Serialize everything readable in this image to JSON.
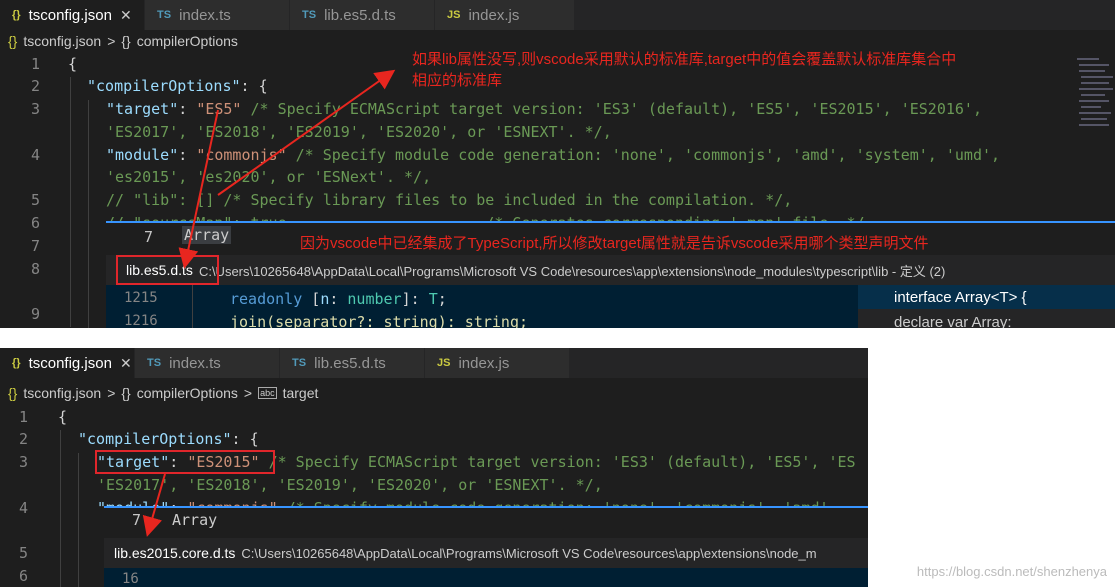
{
  "shot1": {
    "tabs": [
      {
        "icon": "{}",
        "label": "tsconfig.json",
        "close": "✕"
      },
      {
        "icon": "TS",
        "label": "index.ts"
      },
      {
        "icon": "TS",
        "label": "lib.es5.d.ts"
      },
      {
        "icon": "JS",
        "label": "index.js"
      }
    ],
    "breadcrumb": [
      "{}",
      "tsconfig.json",
      ">",
      "{}",
      "compilerOptions"
    ],
    "annotation_top": "如果lib属性没写,则vscode采用默认的标准库,target中的值会覆盖默认标准库集合中",
    "annotation_top2": "相应的标准库",
    "annotation_mid": "因为vscode中已经集成了TypeScript,所以修改target属性就是告诉vscode采用哪个类型声明文件",
    "lines": {
      "l1": "1",
      "l2": "2",
      "l3": "3",
      "l4": "4",
      "l5": "5",
      "l6": "6",
      "l7": "7",
      "l8": "8",
      "l9": "9"
    },
    "code": {
      "brace": "{",
      "compilerOptions": "\"compilerOptions\"",
      "colon_brace": ": {",
      "target_key": "\"target\"",
      "target_val": "\"ES5\"",
      "target_comment": " /* Specify ECMAScript target version: 'ES3' (default), 'ES5', 'ES2015', 'ES2016',",
      "target_comment2": "'ES2017', 'ES2018', 'ES2019', 'ES2020', or 'ESNEXT'. */,",
      "module_key": "\"module\"",
      "module_val": "\"commonjs\"",
      "module_comment": " /* Specify module code generation: 'none', 'commonjs', 'amd', 'system', 'umd',",
      "module_comment2": "'es2015', 'es2020', or 'ESNext'. */,",
      "lib_line": "// \"lib\": [] /* Specify library files to be included in the compilation. */,",
      "sourcemap_line": "// \"sourceMap\": true,                     /* Generates corresponding '.map' file. */"
    },
    "peek": {
      "line_no": "7",
      "word": "Array",
      "file": "lib.es5.d.ts",
      "path": "C:\\Users\\10265648\\AppData\\Local\\Programs\\Microsoft VS Code\\resources\\app\\extensions\\node_modules\\typescript\\lib - 定义 (2)",
      "l1215": "1215",
      "code1215": "readonly [n: number]: T;",
      "l1216": "1216",
      "code1216": "join(separator?: string): string;",
      "ref1": "interface Array<T> {",
      "ref2": "declare var Array: ArrayConstructor"
    }
  },
  "shot2": {
    "tabs": [
      {
        "icon": "{}",
        "label": "tsconfig.json",
        "close": "✕"
      },
      {
        "icon": "TS",
        "label": "index.ts"
      },
      {
        "icon": "TS",
        "label": "lib.es5.d.ts"
      },
      {
        "icon": "JS",
        "label": "index.js"
      }
    ],
    "breadcrumb": [
      "{}",
      "tsconfig.json",
      ">",
      "{}",
      "compilerOptions",
      ">",
      "abc",
      "target"
    ],
    "lines": {
      "l1": "1",
      "l2": "2",
      "l3": "3",
      "l4": "4",
      "l5": "5",
      "l6": "6"
    },
    "code": {
      "brace": "{",
      "compilerOptions": "\"compilerOptions\"",
      "colon_brace": ": {",
      "target_key": "\"target\"",
      "target_val": "\"ES2015\"",
      "target_comment": " /* Specify ECMAScript target version: 'ES3' (default), 'ES5', 'ES",
      "target_comment2": "'ES2017', 'ES2018', 'ES2019', 'ES2020', or 'ESNEXT'. */,",
      "module_key": "\"module\"",
      "module_val": "\"commonjs\"",
      "module_comment": " /* Specify module code generation: 'none', 'commonjs', 'amd',"
    },
    "peek": {
      "line_no": "7",
      "word": "Array",
      "file": "lib.es2015.core.d.ts",
      "path": "C:\\Users\\10265648\\AppData\\Local\\Programs\\Microsoft VS Code\\resources\\app\\extensions\\node_m",
      "l16": "16"
    },
    "watermark": "https://blog.csdn.net/shenzhenya"
  }
}
